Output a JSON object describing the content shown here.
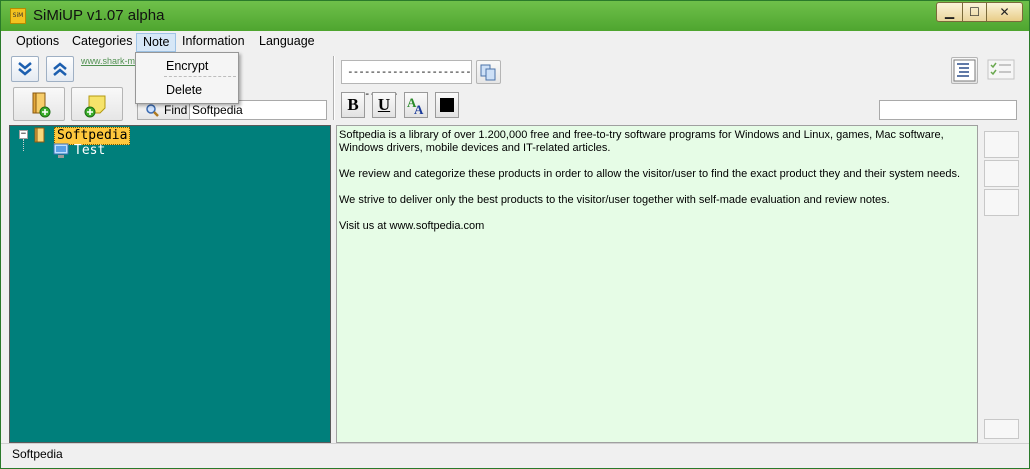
{
  "window": {
    "title": "SiMiUP v1.07 alpha",
    "icon": "app-icon",
    "app_icon_text": "SiM"
  },
  "window_controls": {
    "minimize": "▁",
    "maximize": "☐",
    "close": "✕"
  },
  "menu": {
    "items": [
      {
        "label": "Options"
      },
      {
        "label": "Categories"
      },
      {
        "label": "Note",
        "active": true
      },
      {
        "label": "Information"
      },
      {
        "label": "Language"
      }
    ]
  },
  "note_menu": {
    "items": [
      {
        "label": "Encrypt"
      },
      {
        "label": "Delete"
      }
    ]
  },
  "toolbar_left": {
    "watermark_link": "www.shark-m",
    "find_label": "Find",
    "find_value": "Softpedia"
  },
  "toolbar_right": {
    "combo_value": "-------------------------------",
    "bold_label": "B",
    "underline_label": "U",
    "font_color_label": "A",
    "search_value": ""
  },
  "tree": {
    "nodes": [
      {
        "label": "Softpedia",
        "selected": true,
        "expander": "−",
        "icon": "folder-icon"
      },
      {
        "label": "Test",
        "icon": "computer-icon"
      }
    ]
  },
  "editor": {
    "paragraphs": [
      "Softpedia is a library of over 1.200,000 free and free-to-try software programs for Windows and Linux, games, Mac software, Windows drivers, mobile devices and IT-related articles.",
      "We review and categorize these products in order to allow the visitor/user to find the exact product they and their system needs.",
      "We strive to deliver only the best products to the visitor/user together with self-made evaluation and review notes.",
      "Visit us at www.softpedia.com"
    ]
  },
  "status": {
    "text": "Softpedia"
  },
  "colors": {
    "title_green": "#4ea52f",
    "tree_bg": "#007f7b",
    "editor_bg": "#e6fce6",
    "selection": "#ffc83d"
  }
}
